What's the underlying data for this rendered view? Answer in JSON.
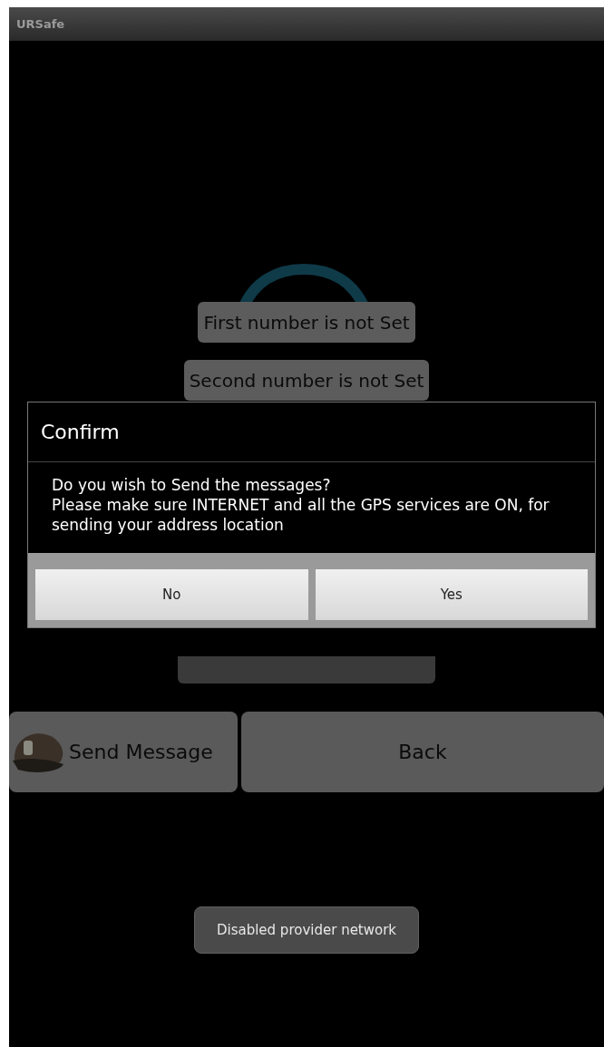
{
  "window": {
    "title": "URSafe"
  },
  "number_buttons": [
    "First number is not Set",
    "Second number is not Set"
  ],
  "actions": [
    {
      "label": "Send Message",
      "kind": "icon"
    },
    {
      "label": "Back",
      "kind": "plain"
    }
  ],
  "dialog": {
    "title": "Confirm",
    "message": "Do you wish to Send the messages?\nPlease make sure INTERNET and all the GPS services are ON, for sending your address location",
    "buttons": [
      "No",
      "Yes"
    ]
  },
  "toast": "Disabled provider network"
}
